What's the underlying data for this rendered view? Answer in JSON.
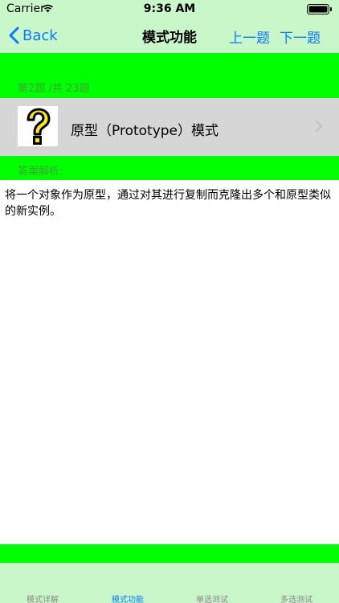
{
  "status_bar": {
    "carrier": "Carrier",
    "time": "9:36 AM",
    "icons": [
      "wifi-icon",
      "battery-icon"
    ]
  },
  "nav": {
    "back_label": "Back",
    "title": "模式功能",
    "prev_label": "上一题",
    "next_label": "下一题",
    "accent_color": "#0a7aff",
    "background_color": "#c9f7c9"
  },
  "question": {
    "counter": "第2题 /共 23题",
    "title": "原型（Prototype）模式",
    "icon": "question-mark-icon"
  },
  "answer": {
    "label": "答案解析:",
    "text": "将一个对象作为原型，通过对其进行复制而克隆出多个和原型类似的新实例。"
  },
  "colors": {
    "band": "#00ff00",
    "row": "#d6d6d6"
  },
  "tabs": [
    {
      "label": "模式详解",
      "active": false
    },
    {
      "label": "模式功能",
      "active": true
    },
    {
      "label": "单选测试",
      "active": false
    },
    {
      "label": "多选测试",
      "active": false
    }
  ]
}
